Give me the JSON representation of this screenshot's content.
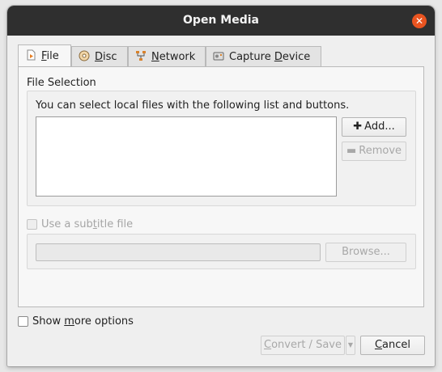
{
  "window": {
    "title": "Open Media"
  },
  "tabs": [
    {
      "pre": "",
      "key": "F",
      "post": "ile",
      "icon": "file-icon"
    },
    {
      "pre": "",
      "key": "D",
      "post": "isc",
      "icon": "disc-icon"
    },
    {
      "pre": "",
      "key": "N",
      "post": "etwork",
      "icon": "network-icon"
    },
    {
      "pre": "Capture ",
      "key": "D",
      "post": "evice",
      "icon": "capture-device-icon"
    }
  ],
  "file_selection": {
    "label": "File Selection",
    "hint": "You can select local files with the following list and buttons.",
    "add_label": "Add...",
    "remove_label": "Remove"
  },
  "subtitle": {
    "pre": "Use a sub",
    "key": "t",
    "post": "itle file",
    "browse_label": "Browse..."
  },
  "options": {
    "pre": "Show ",
    "key": "m",
    "post": "ore options"
  },
  "footer": {
    "convert_pre": "",
    "convert_key": "C",
    "convert_post": "onvert / Save",
    "cancel_pre": "",
    "cancel_key": "C",
    "cancel_post": "ancel"
  },
  "colors": {
    "titlebar": "#2f2f2f",
    "close": "#e95420"
  }
}
